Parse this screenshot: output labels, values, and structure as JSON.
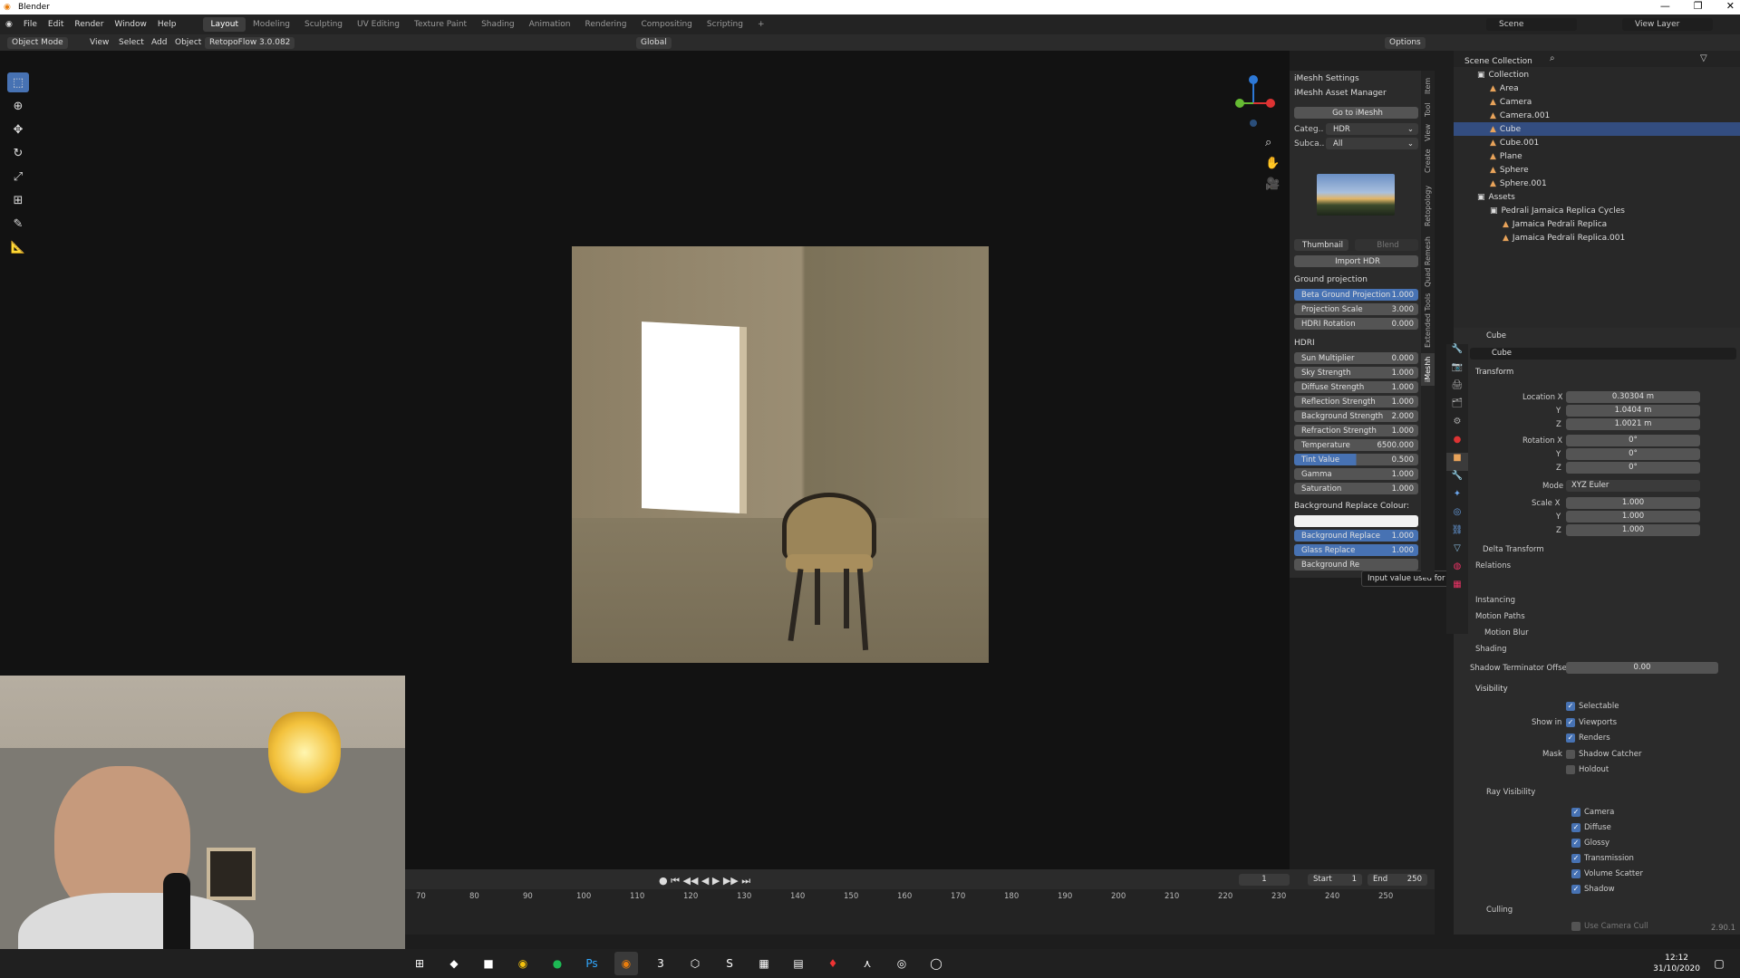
{
  "title": "Blender",
  "menus": [
    "File",
    "Edit",
    "Render",
    "Window",
    "Help"
  ],
  "workspaces": [
    "Layout",
    "Modeling",
    "Sculpting",
    "UV Editing",
    "Texture Paint",
    "Shading",
    "Animation",
    "Rendering",
    "Compositing",
    "Scripting"
  ],
  "scene": "Scene",
  "view_layer": "View Layer",
  "header": {
    "mode": "Object Mode",
    "view": "View",
    "select": "Select",
    "add": "Add",
    "object": "Object",
    "addon": "RetopoFlow 3.0.082",
    "orientation": "Global",
    "options": "Options"
  },
  "imeshh": {
    "settings": "iMeshh Settings",
    "asset_manager": "iMeshh Asset Manager",
    "go_to": "Go to iMeshh",
    "category_label": "Categ..",
    "category_value": "HDR",
    "subcat_label": "Subca..",
    "subcat_value": "All",
    "thumbnail": "Thumbnail",
    "blend": "Blend",
    "import": "Import HDR",
    "ground": "Ground projection",
    "ground_props": [
      [
        "Beta Ground Projection",
        "1.000"
      ],
      [
        "Projection Scale",
        "3.000"
      ],
      [
        "HDRI Rotation",
        "0.000"
      ]
    ],
    "hdri": "HDRI",
    "hdri_props": [
      [
        "Sun Multiplier",
        "0.000"
      ],
      [
        "Sky Strength",
        "1.000"
      ],
      [
        "Diffuse Strength",
        "1.000"
      ],
      [
        "Reflection Strength",
        "1.000"
      ],
      [
        "Background Strength",
        "2.000"
      ],
      [
        "Refraction Strength",
        "1.000"
      ],
      [
        "Temperature",
        "6500.000"
      ],
      [
        "Tint Value",
        "0.500"
      ],
      [
        "Gamma",
        "1.000"
      ],
      [
        "Saturation",
        "1.000"
      ]
    ],
    "bg_replace_colour": "Background Replace Colour:",
    "replace_props": [
      [
        "Background Replace",
        "1.000"
      ],
      [
        "Glass Replace",
        "1.000"
      ],
      [
        "Background Re",
        "",
        ""
      ]
    ],
    "tooltip": "Input value used for unconnected socket."
  },
  "side_tabs": [
    "Item",
    "Tool",
    "View",
    "Create",
    "Retopology",
    "Quad Remesh",
    "Extended Tools",
    "iMeshh"
  ],
  "outliner": {
    "rows": [
      [
        "Scene Collection",
        0
      ],
      [
        "Collection",
        1
      ],
      [
        "Area",
        2
      ],
      [
        "Camera",
        2
      ],
      [
        "Camera.001",
        2
      ],
      [
        "Cube",
        2
      ],
      [
        "Cube.001",
        2
      ],
      [
        "Plane",
        2
      ],
      [
        "Sphere",
        2
      ],
      [
        "Sphere.001",
        2
      ],
      [
        "Assets",
        1
      ],
      [
        "Pedrali Jamaica Replica Cycles",
        2
      ],
      [
        "Jamaica Pedrali Replica",
        3
      ],
      [
        "Jamaica Pedrali Replica.001",
        3
      ]
    ]
  },
  "properties": {
    "object": "Cube",
    "data": "Cube",
    "transform": "Transform",
    "loc_label": "Location X",
    "loc": [
      "0.30304 m",
      "1.0404 m",
      "1.0021 m"
    ],
    "rot_label": "Rotation X",
    "rot": [
      "0°",
      "0°",
      "0°"
    ],
    "mode_label": "Mode",
    "mode": "XYZ Euler",
    "scale_label": "Scale X",
    "scale": [
      "1.000",
      "1.000",
      "1.000"
    ],
    "axes": [
      "Y",
      "Z"
    ],
    "sections": [
      "Delta Transform",
      "Relations",
      "Instancing",
      "Motion Paths",
      "Motion Blur",
      "Shading"
    ],
    "shadow_label": "Shadow Terminator Offset",
    "shadow_value": "0.00",
    "visibility": "Visibility",
    "selectable": "Selectable",
    "show_in": "Show in",
    "viewports": "Viewports",
    "renders": "Renders",
    "mask": "Mask",
    "shadow_catcher": "Shadow Catcher",
    "holdout": "Holdout",
    "ray_visibility": "Ray Visibility",
    "rays": [
      "Camera",
      "Diffuse",
      "Glossy",
      "Transmission",
      "Volume Scatter",
      "Shadow"
    ],
    "culling": "Culling",
    "use_camera_cull": "Use Camera Cull",
    "version": "2.90.1"
  },
  "timeline": {
    "frame": "1",
    "start_label": "Start",
    "start": "1",
    "end_label": "End",
    "end": "250",
    "ticks": [
      "70",
      "80",
      "90",
      "100",
      "110",
      "120",
      "130",
      "140",
      "150",
      "160",
      "170",
      "180",
      "190",
      "200",
      "210",
      "220",
      "230",
      "240",
      "250"
    ]
  },
  "clock": {
    "time": "12:12",
    "date": "31/10/2020"
  }
}
